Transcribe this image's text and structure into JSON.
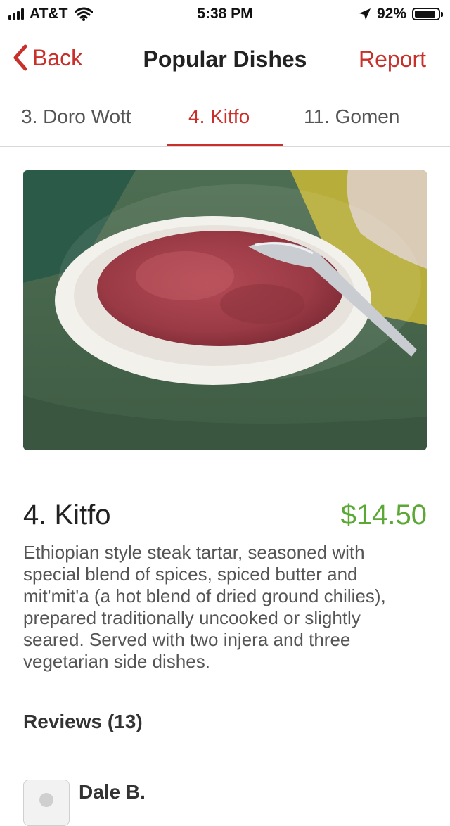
{
  "status_bar": {
    "carrier": "AT&T",
    "time": "5:38 PM",
    "battery_percent": "92%",
    "battery_level": 0.92,
    "signal_icon": "signal-bars-icon",
    "wifi_icon": "wifi-icon",
    "location_icon": "location-arrow-icon"
  },
  "nav": {
    "back_label": "Back",
    "title": "Popular Dishes",
    "report_label": "Report",
    "accent_color": "#c9302c"
  },
  "tabs": [
    {
      "label": "3. Doro Wott",
      "active": false
    },
    {
      "label": "4. Kitfo",
      "active": true
    },
    {
      "label": "11. Gomen",
      "active": false
    }
  ],
  "dish": {
    "name": "4. Kitfo",
    "price": "$14.50",
    "price_color": "#5ba837",
    "description": "Ethiopian style steak tartar, seasoned with special blend of spices, spiced butter and mit'mit'a (a hot blend of dried ground chilies), prepared traditionally uncooked or slightly seared. Served with two injera and three vegetarian side dishes."
  },
  "reviews": {
    "heading": "Reviews (13)",
    "items": [
      {
        "reviewer": "Dale B."
      }
    ]
  }
}
